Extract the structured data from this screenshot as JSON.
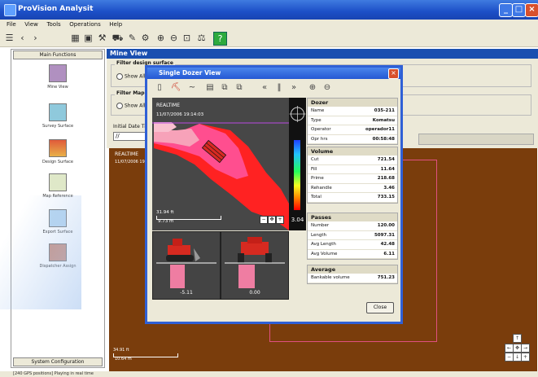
{
  "app": {
    "title": "ProVision Analysit"
  },
  "menu": [
    "File",
    "View",
    "Tools",
    "Operations",
    "Help"
  ],
  "left_panel": {
    "header": "Main Functions",
    "footer": "System Configuration",
    "items": [
      {
        "label": "Mine View",
        "icon": "mine-view-icon"
      },
      {
        "label": "Survey Surface",
        "icon": "survey-surface-icon"
      },
      {
        "label": "Design Surface",
        "icon": "design-surface-icon"
      },
      {
        "label": "Map Reference",
        "icon": "map-reference-icon"
      },
      {
        "label": "Export Surface",
        "icon": "export-surface-icon"
      },
      {
        "label": "Dispatcher Assign",
        "icon": "dispatcher-assign-icon"
      }
    ]
  },
  "main": {
    "header": "Mine View",
    "filter_design_label": "Filter design surface",
    "filter_map_label": "Filter Map R",
    "show_all_1": "Show All",
    "show_all_2": "Show All",
    "initial_date_label": "Initial Date Ti",
    "realtime_label": "REALTIME",
    "datetime": "11/07/2006 19:14:03",
    "scale_ft": "34.91 ft",
    "scale_m": "10.64 m"
  },
  "status": "[240 GPS positions] Playing in real time",
  "dialog": {
    "title": "Single Dozer View",
    "realtime_label": "REALTIME",
    "datetime": "11/07/2006 19:14:03",
    "scale_ft": "31.94 ft",
    "scale_m": "9.73 m",
    "depth_value": "3.04",
    "view_left_value": "-5.11",
    "view_right_value": "0.00",
    "close_label": "Close",
    "dozer": {
      "heading": "Dozer",
      "rows": [
        {
          "k": "Name",
          "v": "035-211"
        },
        {
          "k": "Type",
          "v": "Komatsu"
        },
        {
          "k": "Operator",
          "v": "operador11"
        },
        {
          "k": "Opr hrs",
          "v": "00:58:48"
        }
      ]
    },
    "volume": {
      "heading": "Volume",
      "rows": [
        {
          "k": "Cut",
          "v": "721.54"
        },
        {
          "k": "Fill",
          "v": "11.64"
        },
        {
          "k": "Prime",
          "v": "218.68"
        },
        {
          "k": "Rehandle",
          "v": "3.46"
        },
        {
          "k": "Total",
          "v": "733.15"
        }
      ]
    },
    "passes": {
      "heading": "Passes",
      "rows": [
        {
          "k": "Number",
          "v": "120.00"
        },
        {
          "k": "Length",
          "v": "5097.31"
        },
        {
          "k": "Avg Length",
          "v": "42.48"
        },
        {
          "k": "Avg Volume",
          "v": "6.11"
        }
      ]
    },
    "average": {
      "heading": "Average",
      "rows": [
        {
          "k": "Bankable volume",
          "v": "751.23"
        }
      ]
    }
  },
  "colors": {
    "accent": "#2458d3",
    "terrain": "#7a3d0c",
    "cut": "#e8112d",
    "fill": "#f5a3b8"
  }
}
